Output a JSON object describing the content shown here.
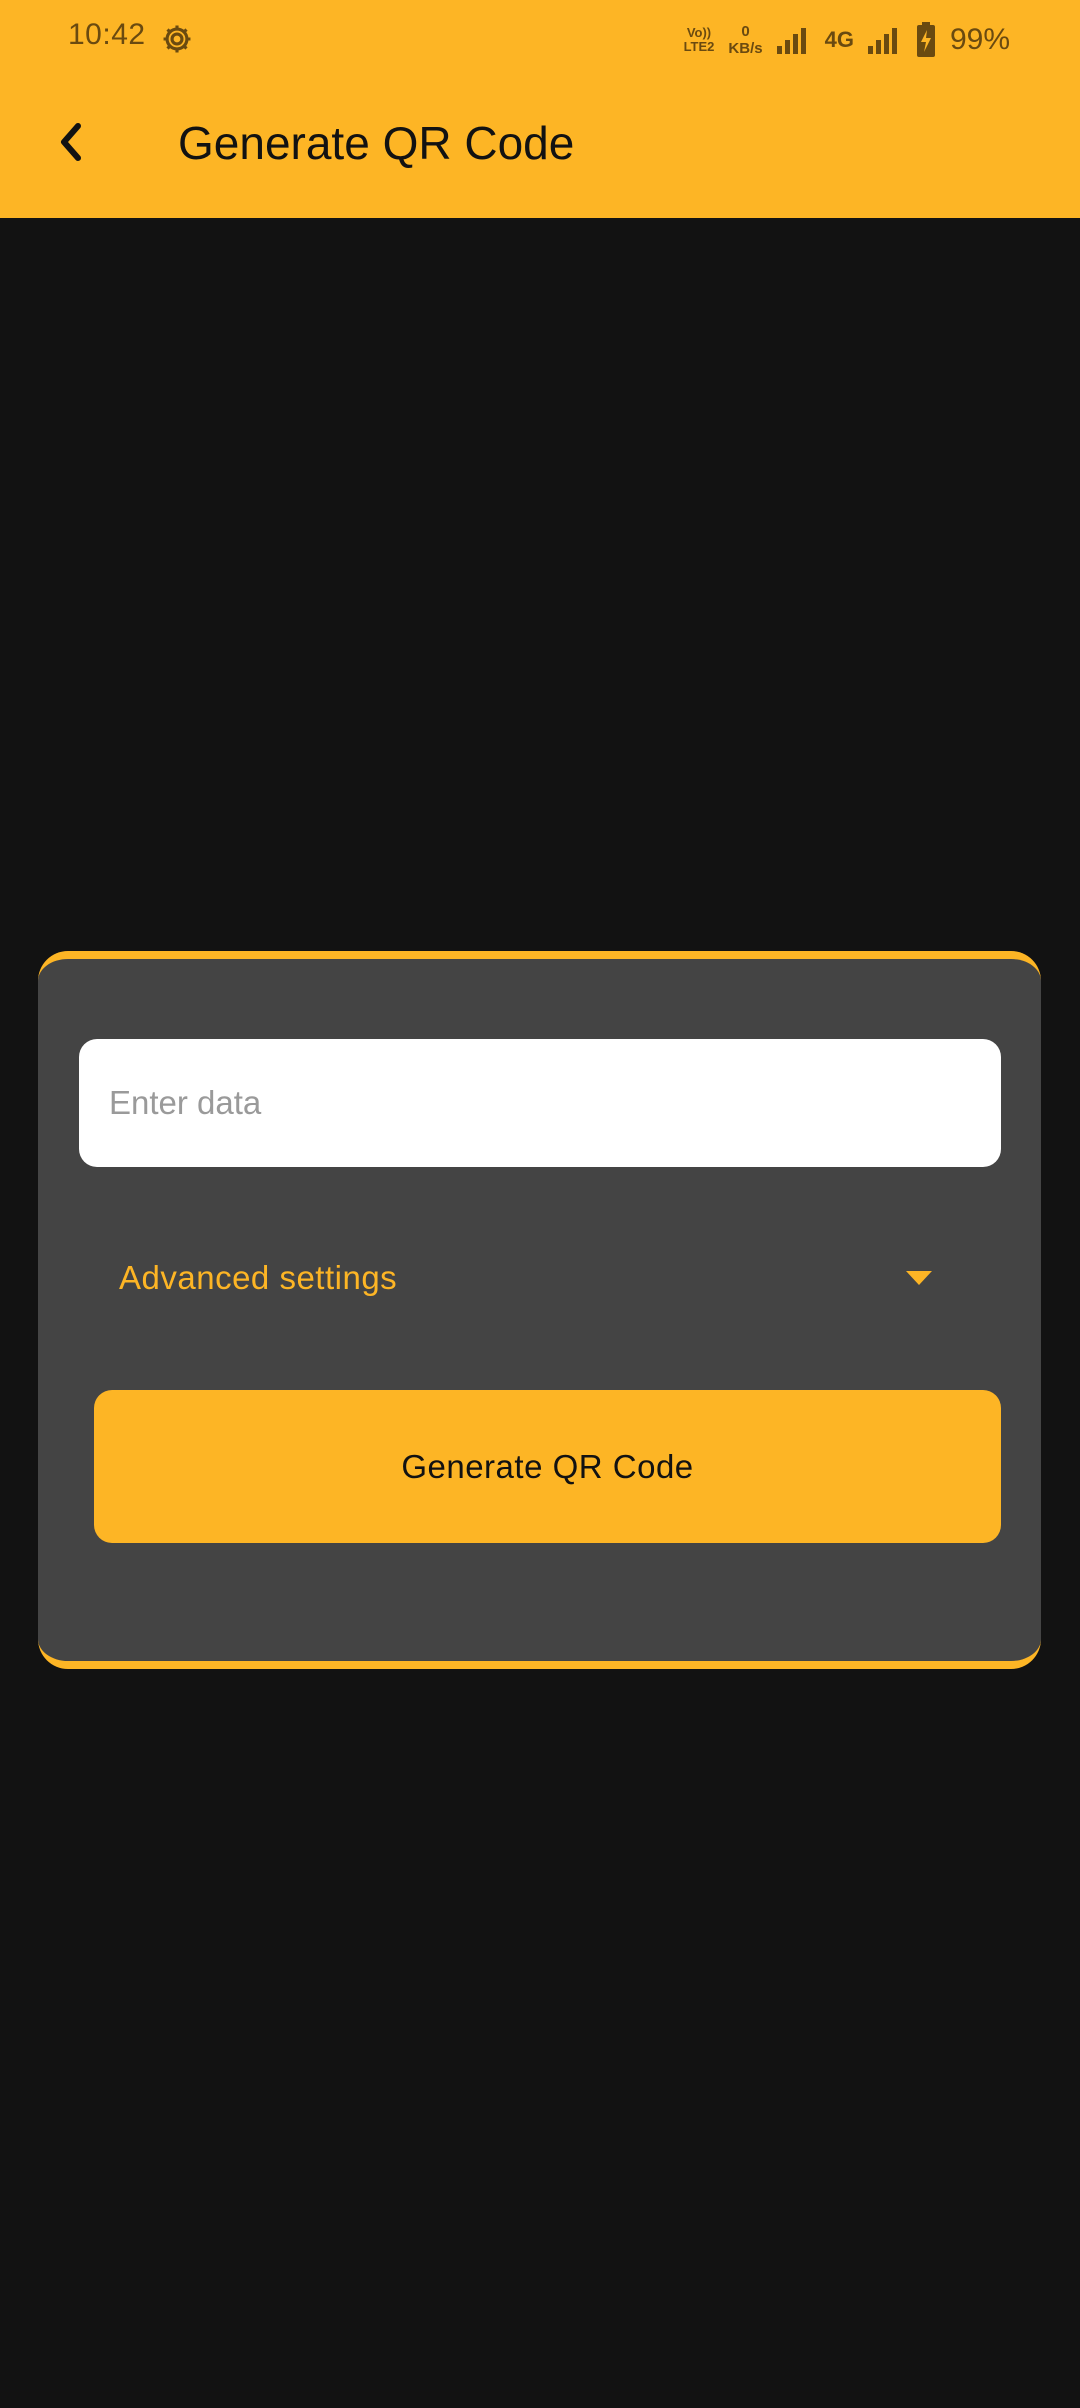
{
  "status_bar": {
    "time": "10:42",
    "volte_top": "Vo))",
    "volte_bottom": "LTE2",
    "speed_value": "0",
    "speed_unit": "KB/s",
    "network": "4G",
    "battery": "99%"
  },
  "app_bar": {
    "title": "Generate QR Code",
    "back_icon": "chevron-left-icon"
  },
  "form": {
    "data_placeholder": "Enter data",
    "data_value": "",
    "advanced_label": "Advanced settings",
    "advanced_icon": "caret-down-icon",
    "generate_label": "Generate QR Code"
  },
  "colors": {
    "accent": "#FDB525",
    "background": "#121212",
    "card": "#444444",
    "status_text": "#6A4A10"
  }
}
